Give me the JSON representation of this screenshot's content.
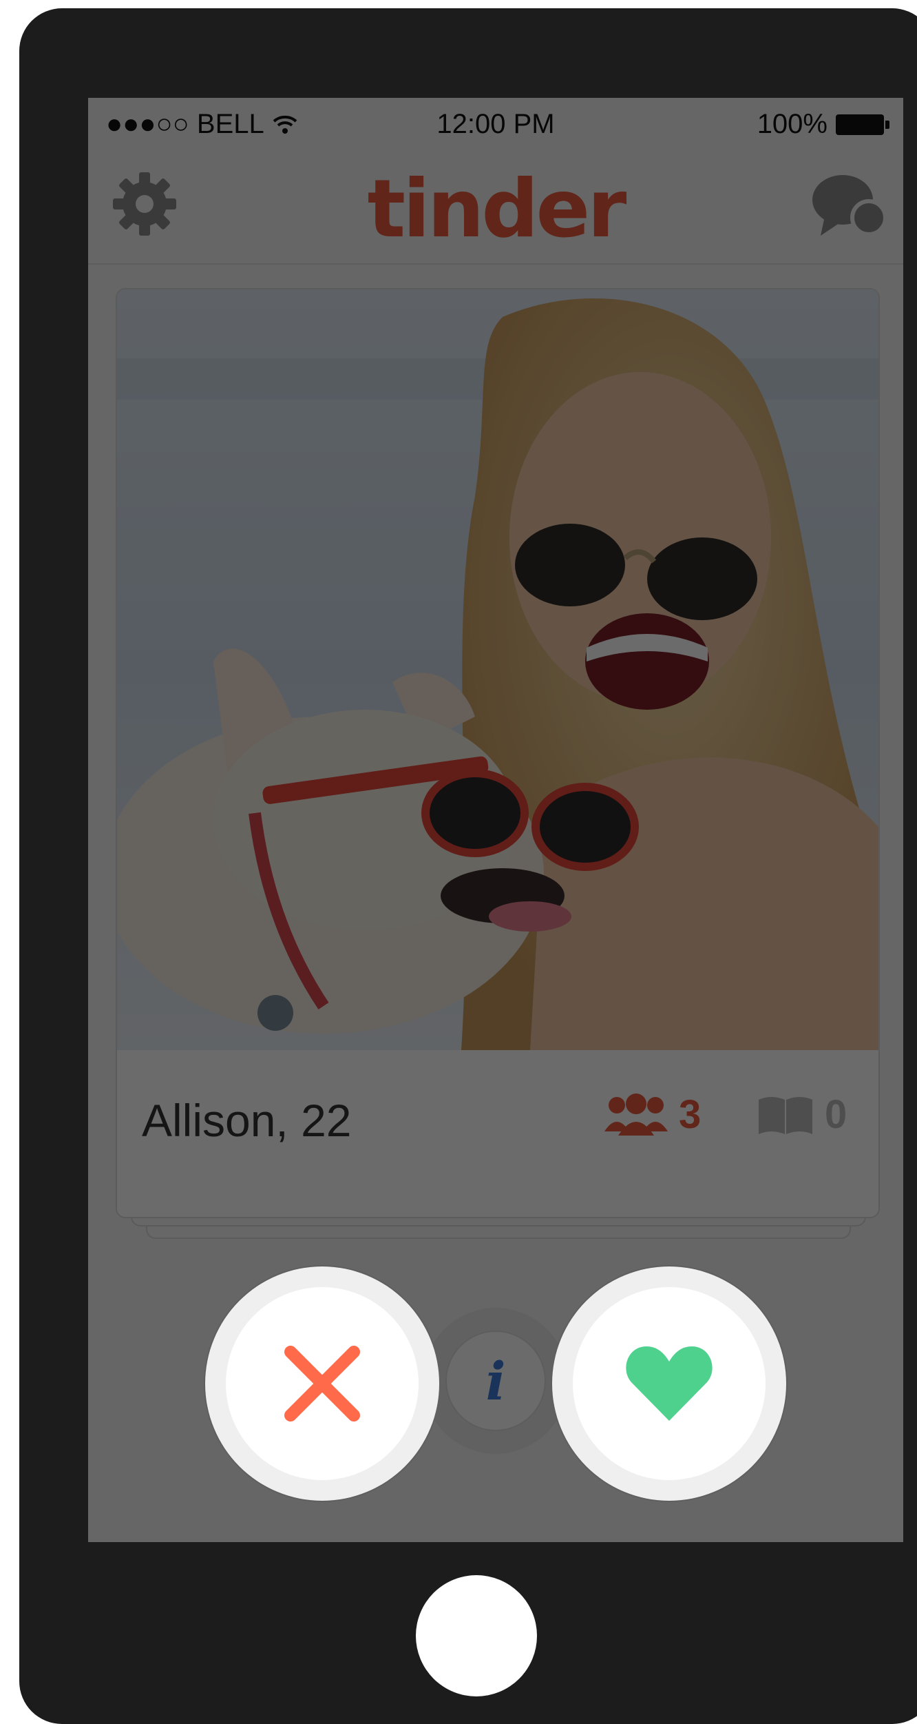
{
  "status_bar": {
    "carrier": "●●●○○ BELL",
    "time": "12:00 PM",
    "battery": "100%"
  },
  "nav": {
    "logo": "tinder",
    "left_icon": "gear-icon",
    "right_icon": "chat-icon"
  },
  "card": {
    "name_age": "Allison, 22",
    "common_friends": "3",
    "common_interests": "0",
    "photo_description_icon": "profile-photo"
  },
  "actions": {
    "nope_icon": "close-icon",
    "info_label": "i",
    "like_icon": "heart-icon"
  },
  "colors": {
    "brand": "#e75a3c",
    "nope": "#ff6b4a",
    "like": "#4fd18e",
    "info": "#3e7bd6",
    "phone_frame": "#1c1c1c"
  }
}
